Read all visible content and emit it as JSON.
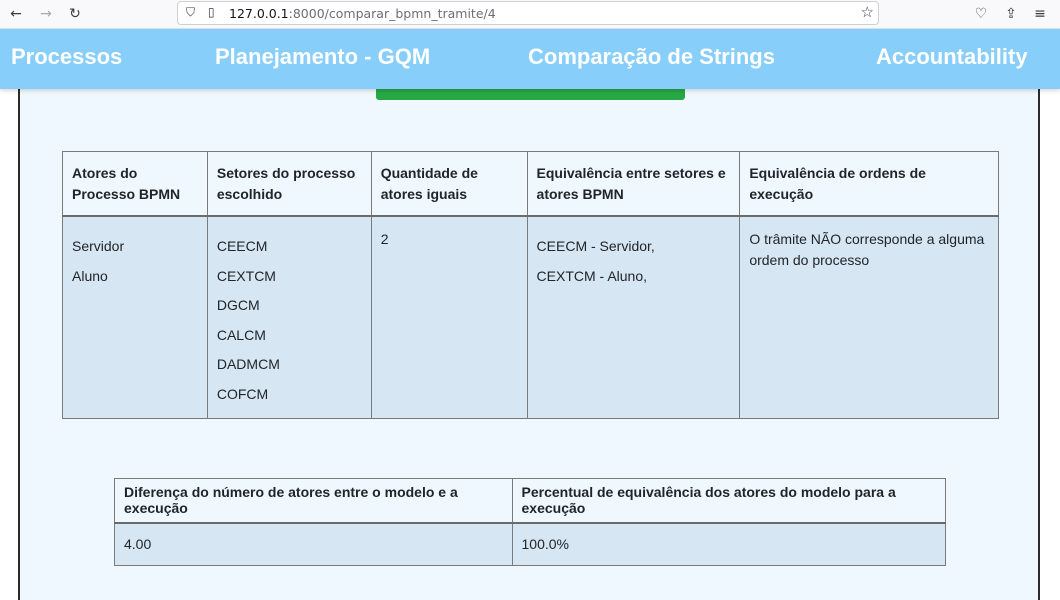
{
  "browser": {
    "url_host": "127.0.0.1",
    "url_rest": ":8000/comparar_bpmn_tramite/4"
  },
  "nav": {
    "items": [
      "Processos",
      "Planejamento - GQM",
      "Comparação de Strings",
      "Accountability"
    ]
  },
  "main_table": {
    "headers": [
      "Atores do Processo BPMN",
      "Setores do processo escolhido",
      "Quantidade de atores iguais",
      "Equivalência entre setores e atores BPMN",
      "Equivalência de ordens de execução"
    ],
    "actors": [
      "Servidor",
      "Aluno"
    ],
    "sectors": [
      "CEECM",
      "CEXTCM",
      "DGCM",
      "CALCM",
      "DADMCM",
      "COFCM"
    ],
    "equal_count": "2",
    "equivalences": [
      "CEECM - Servidor,",
      "CEXTCM - Aluno,"
    ],
    "order_equivalence": "O trâmite NÃO corresponde a alguma ordem do processo"
  },
  "summary_table": {
    "headers": [
      "Diferença do número de atores entre o modelo e a execução",
      "Percentual de equivalência dos atores do modelo para a execução"
    ],
    "values": [
      "4.00",
      "100.0%"
    ]
  }
}
